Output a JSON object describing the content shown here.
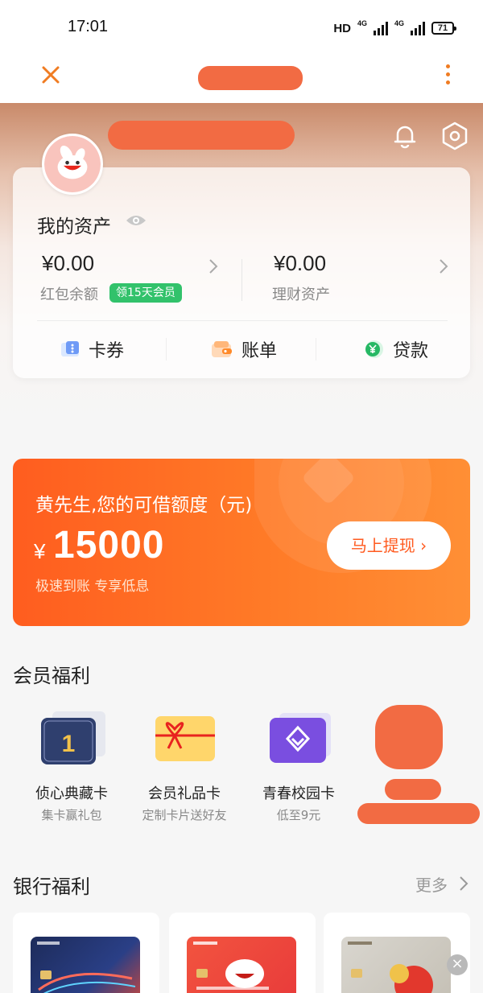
{
  "status_bar": {
    "time": "17:01",
    "hd": "HD",
    "network1": "4G",
    "network2": "4G",
    "battery": "71"
  },
  "assets": {
    "title": "我的资产",
    "red_packet_amount": "¥0.00",
    "red_packet_label": "红包余额",
    "member_badge": "领15天会员",
    "wealth_amount": "¥0.00",
    "wealth_label": "理财资产"
  },
  "tools": [
    {
      "label": "卡券",
      "icon": "coupon-icon"
    },
    {
      "label": "账单",
      "icon": "wallet-icon"
    },
    {
      "label": "贷款",
      "icon": "loan-yen-icon"
    }
  ],
  "loan": {
    "title": "黄先生,您的可借额度（元)",
    "currency": "¥",
    "amount": "15000",
    "subtitle": "极速到账 专享低息",
    "button": "马上提现 ›"
  },
  "member_perks": {
    "title": "会员福利",
    "items": [
      {
        "name": "侦心典藏卡",
        "sub": "集卡赢礼包"
      },
      {
        "name": "会员礼品卡",
        "sub": "定制卡片送好友"
      },
      {
        "name": "青春校园卡",
        "sub": "低至9元"
      }
    ]
  },
  "bank_perks": {
    "title": "银行福利",
    "more": "更多"
  },
  "colors": {
    "orange_accent": "#f07c22",
    "loan_gradient_start": "#ff5d1f",
    "member_green": "#32c26b"
  }
}
